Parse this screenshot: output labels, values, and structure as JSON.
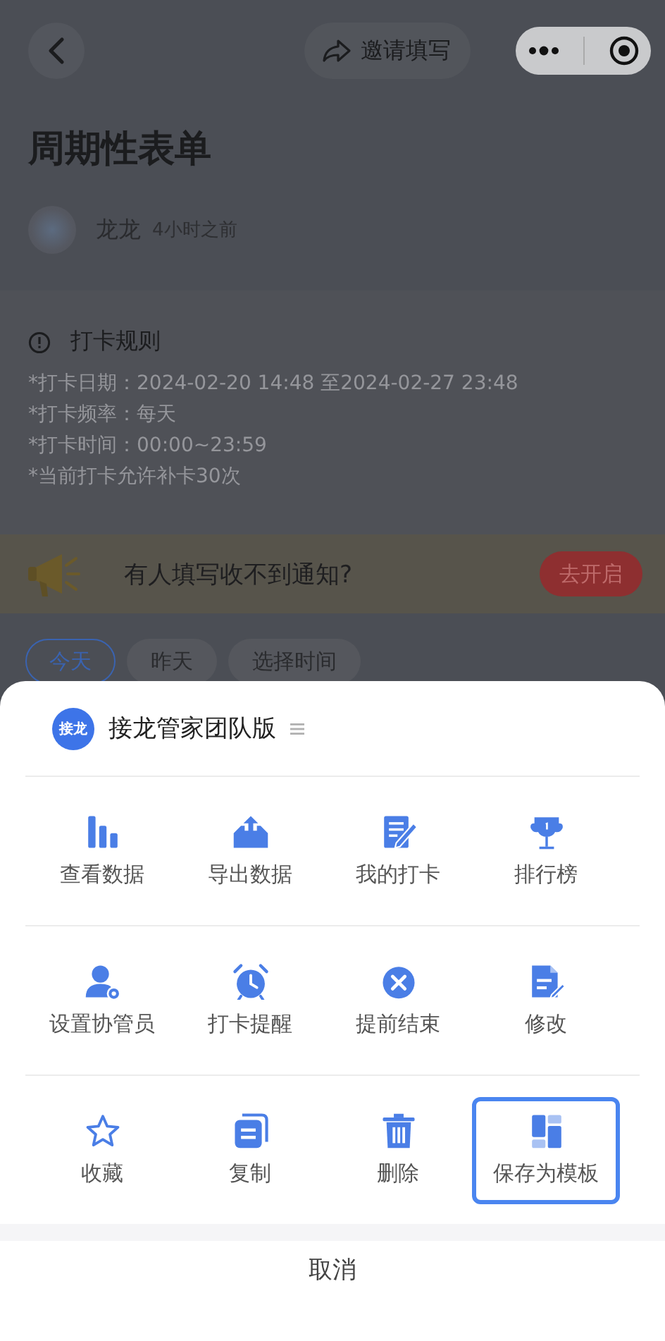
{
  "nav": {
    "invite": "邀请填写"
  },
  "title": "周期性表单",
  "author": {
    "name": "龙龙",
    "time": "4小时之前"
  },
  "rules": {
    "heading": "打卡规则",
    "lines": [
      "*打卡日期：2024-02-20 14:48 至2024-02-27 23:48",
      "*打卡频率：每天",
      "*打卡时间：00:00~23:59",
      "*当前打卡允许补卡30次"
    ]
  },
  "banner": {
    "text": "有人填写收不到通知?",
    "button": "去开启"
  },
  "date_tabs": [
    {
      "label": "今天",
      "selected": true
    },
    {
      "label": "昨天",
      "selected": false
    },
    {
      "label": "选择时间",
      "selected": false
    }
  ],
  "sheet": {
    "logo": "接龙",
    "app_name": "接龙管家团队版",
    "action_rows": [
      {
        "actions": [
          {
            "kind": "chart",
            "label": "查看数据",
            "selected": false
          },
          {
            "kind": "export",
            "label": "导出数据",
            "selected": false
          },
          {
            "kind": "note",
            "label": "我的打卡",
            "selected": false
          },
          {
            "kind": "trophy",
            "label": "排行榜",
            "selected": false
          }
        ]
      },
      {
        "actions": [
          {
            "kind": "user",
            "label": "设置协管员",
            "selected": false
          },
          {
            "kind": "alarm",
            "label": "打卡提醒",
            "selected": false
          },
          {
            "kind": "close",
            "label": "提前结束",
            "selected": false
          },
          {
            "kind": "doc",
            "label": "修改",
            "selected": false
          }
        ]
      },
      {
        "actions": [
          {
            "kind": "star",
            "label": "收藏",
            "selected": false
          },
          {
            "kind": "copy",
            "label": "复制",
            "selected": false
          },
          {
            "kind": "trash",
            "label": "删除",
            "selected": false
          },
          {
            "kind": "template",
            "label": "保存为模板",
            "selected": true
          }
        ]
      }
    ],
    "cancel": "取消"
  }
}
